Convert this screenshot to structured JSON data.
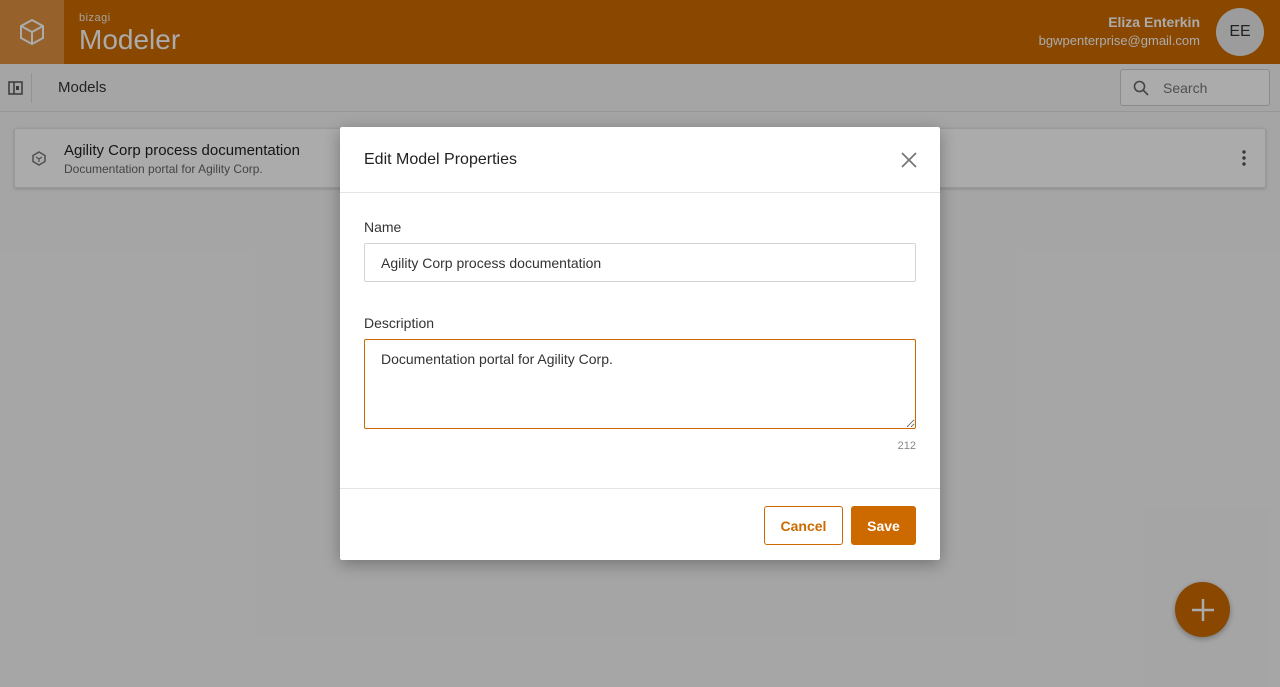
{
  "header": {
    "brand_small": "bizagi",
    "brand_big": "Modeler",
    "user_name": "Eliza Enterkin",
    "user_email": "bgwpenterprise@gmail.com",
    "avatar_initials": "EE",
    "color": "#cc6a00"
  },
  "subbar": {
    "title": "Models",
    "search_placeholder": "Search"
  },
  "model_card": {
    "title": "Agility Corp process documentation",
    "description": "Documentation portal for Agility Corp."
  },
  "modal": {
    "title": "Edit Model Properties",
    "name_label": "Name",
    "name_value": "Agility Corp process documentation",
    "description_label": "Description",
    "description_value": "Documentation portal for Agility Corp.",
    "char_counter": "212",
    "cancel_label": "Cancel",
    "save_label": "Save"
  }
}
